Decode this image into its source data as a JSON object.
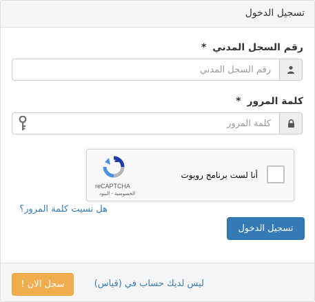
{
  "panel": {
    "title": "تسجيل الدخول"
  },
  "civil_id": {
    "label": "رقم السجل المدني",
    "required_mark": "*",
    "placeholder": "رقم السجل المدني",
    "value": "",
    "icon": "user-icon"
  },
  "password": {
    "label": "كلمة المرور",
    "required_mark": "*",
    "placeholder": "كلمة المرور",
    "value": "",
    "icon": "lock-icon",
    "extra_icon": "key-icon"
  },
  "recaptcha": {
    "checkbox_label": "أنا لست برنامج روبوت",
    "brand": "reCAPTCHA",
    "links": "الخصوصية - البنود",
    "checked": false
  },
  "forgot_password": "هل نسيت كلمة المرور؟",
  "login_button": "تسجيل الدخول",
  "footer": {
    "text": "ليس لديك حساب في (قياس)",
    "register_button": "سجل الان !"
  },
  "colors": {
    "primary": "#337ab7",
    "warning": "#f0ad4e",
    "panel_bg": "#f5f5f5",
    "border": "#dddddd"
  }
}
